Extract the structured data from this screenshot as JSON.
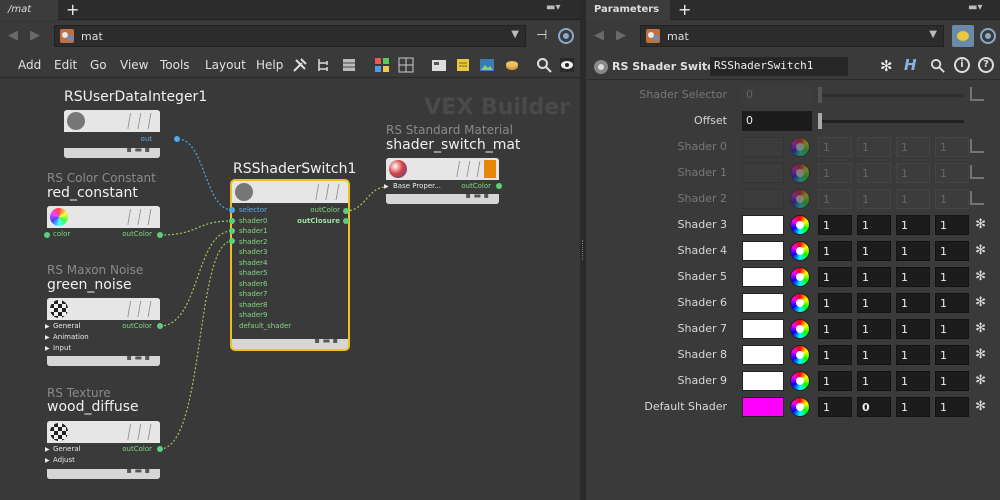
{
  "left": {
    "tab_label": "/mat",
    "path": "mat",
    "menu": [
      "Add",
      "Edit",
      "Go",
      "View",
      "Tools",
      "Layout",
      "Help"
    ],
    "watermark": "VEX Builder",
    "nodes": {
      "userdata": {
        "title": "RSUserDataInteger1",
        "port_out": "out"
      },
      "constant": {
        "caption": "RS Color Constant",
        "title": "red_constant",
        "port_in": "color",
        "port_out": "outColor"
      },
      "noise": {
        "caption": "RS Maxon Noise",
        "title": "green_noise",
        "inputs": [
          "General",
          "Animation",
          "Input"
        ],
        "port_out": "outColor"
      },
      "texture": {
        "caption": "RS Texture",
        "title": "wood_diffuse",
        "inputs": [
          "General",
          "Adjust"
        ],
        "port_out": "outColor"
      },
      "switch": {
        "title": "RSShaderSwitch1",
        "inputs": [
          "selector",
          "shader0",
          "shader1",
          "shader2",
          "shader3",
          "shader4",
          "shader5",
          "shader6",
          "shader7",
          "shader8",
          "shader9",
          "default_shader"
        ],
        "outputs": [
          "outColor",
          "outClosure"
        ]
      },
      "material": {
        "caption": "RS Standard Material",
        "title": "shader_switch_mat",
        "port_in": "Base Proper...",
        "port_out": "outColor"
      }
    }
  },
  "right": {
    "tab_label": "Parameters",
    "path": "mat",
    "node_type": "RS Shader Switch",
    "node_name": "RSShaderSwitch1",
    "shader_selector": {
      "label": "Shader Selector",
      "value": "0"
    },
    "offset": {
      "label": "Offset",
      "value": "0"
    },
    "shaders": [
      {
        "label": "Shader 0",
        "enabled": false,
        "color": "#3c3c3c",
        "values": [
          "1",
          "1",
          "1",
          "1"
        ]
      },
      {
        "label": "Shader 1",
        "enabled": false,
        "color": "#3c3c3c",
        "values": [
          "1",
          "1",
          "1",
          "1"
        ]
      },
      {
        "label": "Shader 2",
        "enabled": false,
        "color": "#3c3c3c",
        "values": [
          "1",
          "1",
          "1",
          "1"
        ]
      },
      {
        "label": "Shader 3",
        "enabled": true,
        "color": "#ffffff",
        "values": [
          "1",
          "1",
          "1",
          "1"
        ]
      },
      {
        "label": "Shader 4",
        "enabled": true,
        "color": "#ffffff",
        "values": [
          "1",
          "1",
          "1",
          "1"
        ]
      },
      {
        "label": "Shader 5",
        "enabled": true,
        "color": "#ffffff",
        "values": [
          "1",
          "1",
          "1",
          "1"
        ]
      },
      {
        "label": "Shader 6",
        "enabled": true,
        "color": "#ffffff",
        "values": [
          "1",
          "1",
          "1",
          "1"
        ]
      },
      {
        "label": "Shader 7",
        "enabled": true,
        "color": "#ffffff",
        "values": [
          "1",
          "1",
          "1",
          "1"
        ]
      },
      {
        "label": "Shader 8",
        "enabled": true,
        "color": "#ffffff",
        "values": [
          "1",
          "1",
          "1",
          "1"
        ]
      },
      {
        "label": "Shader 9",
        "enabled": true,
        "color": "#ffffff",
        "values": [
          "1",
          "1",
          "1",
          "1"
        ]
      },
      {
        "label": "Default Shader",
        "enabled": true,
        "color": "#ff00ff",
        "values": [
          "1",
          "0",
          "1",
          "1"
        ]
      }
    ]
  }
}
